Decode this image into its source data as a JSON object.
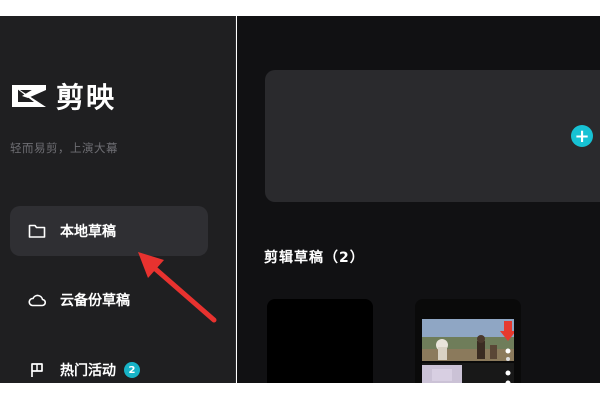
{
  "app": {
    "name": "剪映",
    "slogan": "轻而易剪，上演大幕"
  },
  "sidebar": {
    "items": [
      {
        "label": "本地草稿",
        "icon": "folder-icon",
        "active": true
      },
      {
        "label": "云备份草稿",
        "icon": "cloud-icon",
        "active": false
      },
      {
        "label": "热门活动",
        "icon": "flag-icon",
        "active": false,
        "badge": "2"
      }
    ]
  },
  "main": {
    "create_button_glyph": "+",
    "drafts_title": "剪辑草稿（2）"
  },
  "colors": {
    "accent": "#17c2d4",
    "sidebar_bg": "#1f1f21",
    "main_bg": "#111113",
    "annotation_arrow": "#e8322f"
  }
}
